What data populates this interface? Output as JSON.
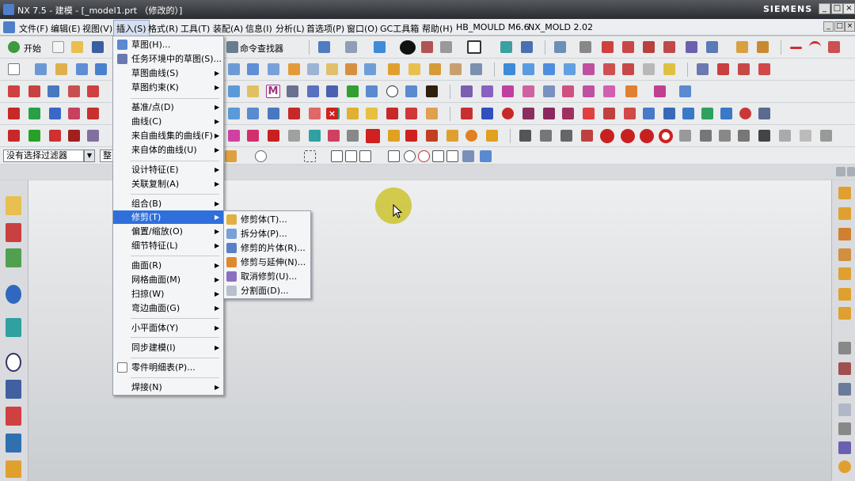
{
  "window": {
    "title": "NX 7.5 - 建模 - [_model1.prt （修改的）]",
    "brand": "SIEMENS"
  },
  "menubar": {
    "items": [
      "文件(F)",
      "编辑(E)",
      "视图(V)",
      "插入(S)",
      "格式(R)",
      "工具(T)",
      "装配(A)",
      "信息(I)",
      "分析(L)",
      "首选项(P)",
      "窗口(O)",
      "GC工具箱",
      "帮助(H)",
      "HB_MOULD M6.6",
      "NX_MOLD 2.02"
    ],
    "open_item": "插入(S)"
  },
  "toolbar": {
    "start_label": "开始",
    "command_finder_label": "命令查找器"
  },
  "selection_bar": {
    "filter_value": "没有选择过滤器",
    "scope_value": "整"
  },
  "insert_menu": {
    "items": [
      {
        "label": "草图(H)...",
        "icon": "sketch-icon",
        "has_submenu": false
      },
      {
        "label": "任务环境中的草图(S)...",
        "icon": "sketch-task-icon",
        "has_submenu": false
      },
      {
        "label": "草图曲线(S)",
        "has_submenu": true
      },
      {
        "label": "草图约束(K)",
        "has_submenu": true
      },
      {
        "label": "基准/点(D)",
        "has_submenu": true
      },
      {
        "label": "曲线(C)",
        "has_submenu": true
      },
      {
        "label": "来自曲线集的曲线(F)",
        "has_submenu": true
      },
      {
        "label": "来自体的曲线(U)",
        "has_submenu": true
      },
      {
        "label": "设计特征(E)",
        "has_submenu": true
      },
      {
        "label": "关联复制(A)",
        "has_submenu": true
      },
      {
        "label": "组合(B)",
        "has_submenu": true
      },
      {
        "label": "修剪(T)",
        "has_submenu": true,
        "highlighted": true
      },
      {
        "label": "偏置/缩放(O)",
        "has_submenu": true
      },
      {
        "label": "细节特征(L)",
        "has_submenu": true
      },
      {
        "label": "曲面(R)",
        "has_submenu": true
      },
      {
        "label": "网格曲面(M)",
        "has_submenu": true
      },
      {
        "label": "扫掠(W)",
        "has_submenu": true
      },
      {
        "label": "弯边曲面(G)",
        "has_submenu": true
      },
      {
        "label": "小平面体(Y)",
        "has_submenu": true
      },
      {
        "label": "同步建模(I)",
        "has_submenu": true
      },
      {
        "label": "零件明细表(P)...",
        "icon": "parts-list-icon",
        "has_submenu": false
      },
      {
        "label": "焊接(N)",
        "has_submenu": true
      }
    ]
  },
  "trim_submenu": {
    "items": [
      {
        "label": "修剪体(T)...",
        "icon": "trim-body-icon"
      },
      {
        "label": "拆分体(P)...",
        "icon": "split-body-icon"
      },
      {
        "label": "修剪的片体(R)...",
        "icon": "trimmed-sheet-icon"
      },
      {
        "label": "修剪与延伸(N)...",
        "icon": "trim-extend-icon"
      },
      {
        "label": "取消修剪(U)...",
        "icon": "untrim-icon"
      },
      {
        "label": "分割面(D)...",
        "icon": "divide-face-icon"
      }
    ]
  },
  "colors": {
    "menu_highlight": "#2f6fdb",
    "titlebar": "#3a3d42",
    "cursor_highlight": "#c8be14"
  }
}
